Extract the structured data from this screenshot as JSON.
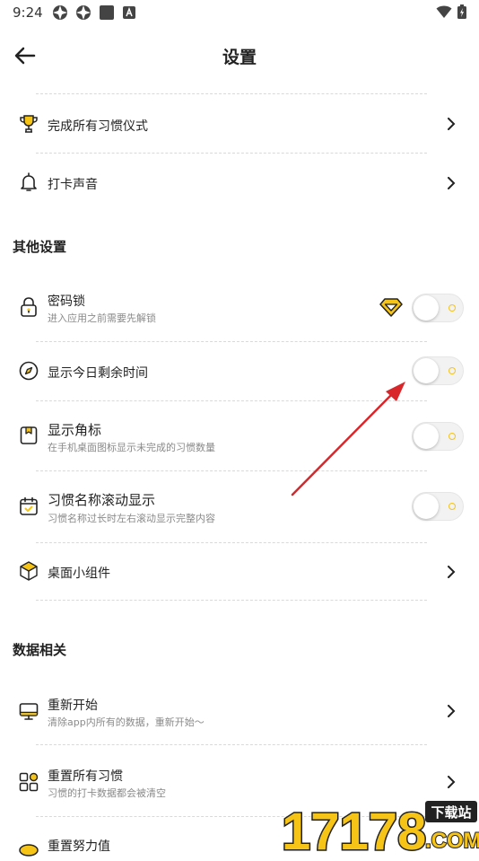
{
  "status_bar": {
    "time": "9:24"
  },
  "app_bar": {
    "title": "设置"
  },
  "rows_top": [
    {
      "title": "完成所有习惯仪式"
    },
    {
      "title": "打卡声音"
    }
  ],
  "other_settings": {
    "header": "其他设置",
    "password_lock": {
      "title": "密码锁",
      "subtitle": "进入应用之前需要先解锁",
      "on": false
    },
    "show_remaining": {
      "title": "显示今日剩余时间",
      "on": false
    },
    "show_badge": {
      "title": "显示角标",
      "subtitle": "在手机桌面图标显示未完成的习惯数量",
      "on": false
    },
    "scroll_name": {
      "title": "习惯名称滚动显示",
      "subtitle": "习惯名称过长时左右滚动显示完整内容",
      "on": false
    },
    "widget": {
      "title": "桌面小组件"
    }
  },
  "data_section": {
    "header": "数据相关",
    "restart": {
      "title": "重新开始",
      "subtitle": "清除app内所有的数据，重新开始～"
    },
    "reset_all": {
      "title": "重置所有习惯",
      "subtitle": "习惯的打卡数据都会被清空"
    },
    "reset_effort": {
      "title": "重置努力值"
    }
  },
  "watermark": {
    "digits": "17178",
    "badge": "下载站",
    "domain": ".COM"
  },
  "colors": {
    "accent": "#f5c417",
    "annotation_arrow": "#d9262b"
  }
}
